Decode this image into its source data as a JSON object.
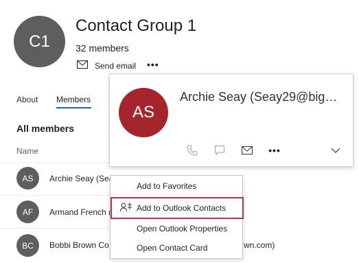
{
  "group": {
    "initials": "C1",
    "title": "Contact Group 1",
    "member_count": "32 members",
    "send_email_label": "Send email",
    "more_label": "•••"
  },
  "tabs": [
    {
      "label": "About",
      "selected": false
    },
    {
      "label": "Members",
      "selected": true
    }
  ],
  "section_title": "All members",
  "column_header": "Name",
  "members": [
    {
      "initials": "AS",
      "name": "Archie Seay (Sea"
    },
    {
      "initials": "AF",
      "name": "Armand French ("
    },
    {
      "initials": "BC",
      "name": "Bobbi Brown Co",
      "suffix": "wn.com)"
    }
  ],
  "contact_card": {
    "initials": "AS",
    "name": "Archie Seay (Seay29@big…",
    "avatar_color": "#a4262c",
    "more_label": "•••"
  },
  "context_menu": {
    "items": [
      {
        "label": "Add to Favorites",
        "highlighted": false
      },
      {
        "label": "Add to Outlook Contacts",
        "highlighted": true
      },
      {
        "label": "Open Outlook Properties",
        "highlighted": false
      },
      {
        "label": "Open Contact Card",
        "highlighted": false
      }
    ]
  },
  "colors": {
    "accent": "#0f6cbd",
    "avatar_gray": "#605e5c",
    "highlight_border": "#c4314b"
  }
}
